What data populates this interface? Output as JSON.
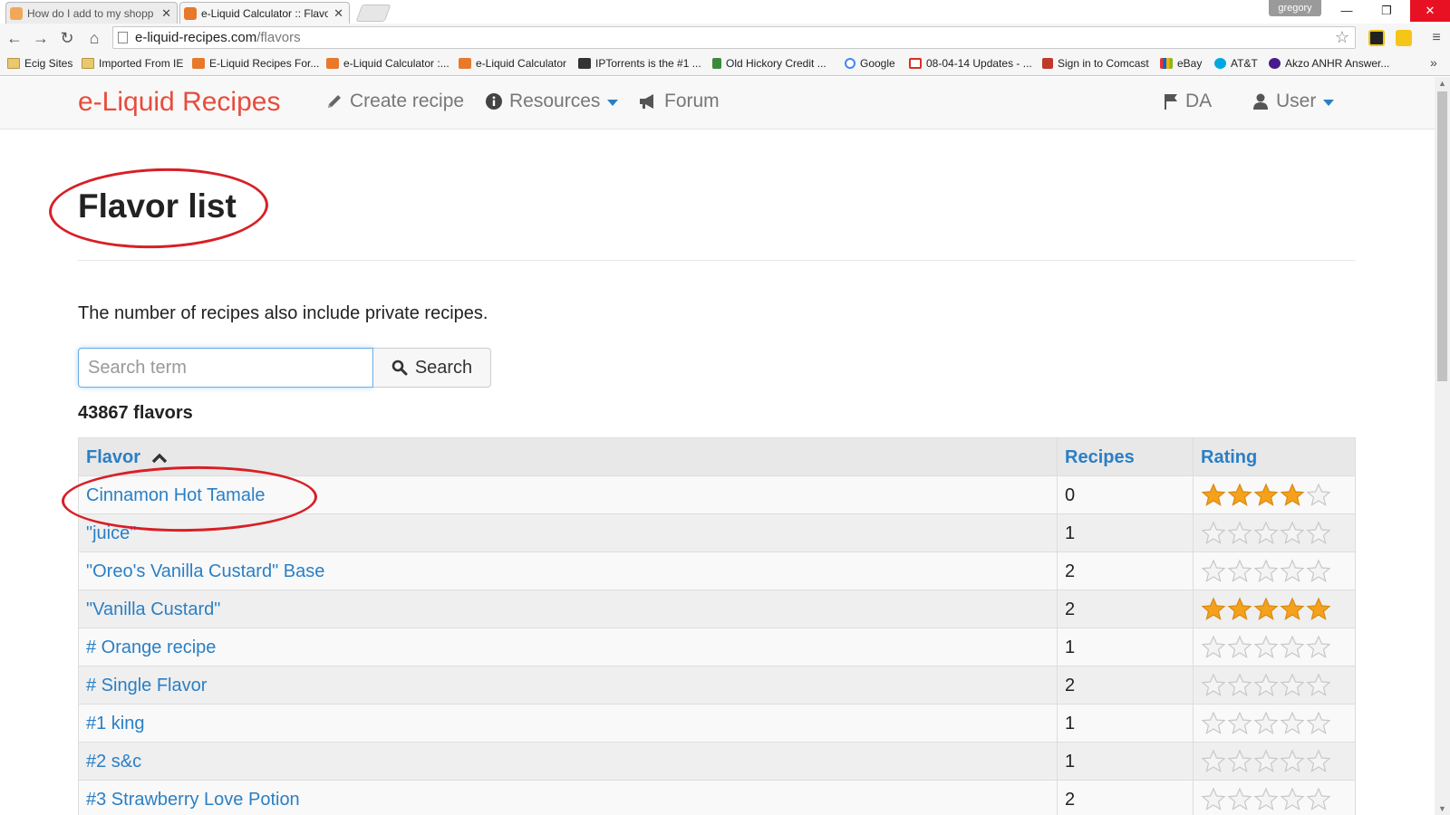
{
  "browser": {
    "tabs": [
      {
        "title": "How do I add to my shopp",
        "active": false
      },
      {
        "title": "e-Liquid Calculator :: Flavo",
        "active": true
      }
    ],
    "profile_name": "gregory",
    "url_host": "e-liquid-recipes.com",
    "url_path": "/flavors",
    "bookmarks": [
      {
        "label": "Ecig Sites",
        "icon": "folder-icon"
      },
      {
        "label": "Imported From IE",
        "icon": "folder-icon"
      },
      {
        "label": "E-Liquid Recipes For...",
        "icon": "eliquid-favicon"
      },
      {
        "label": "e-Liquid Calculator :...",
        "icon": "eliquid-favicon"
      },
      {
        "label": "e-Liquid Calculator",
        "icon": "eliquid-favicon"
      },
      {
        "label": "IPTorrents is the #1 ...",
        "icon": "ipt-favicon"
      },
      {
        "label": "Old Hickory Credit ...",
        "icon": "oldhickory-favicon"
      },
      {
        "label": "Google",
        "icon": "google-favicon"
      },
      {
        "label": "08-04-14 Updates - ...",
        "icon": "gmail-favicon"
      },
      {
        "label": "Sign in to Comcast",
        "icon": "xfinity-favicon"
      },
      {
        "label": "eBay",
        "icon": "ebay-favicon"
      },
      {
        "label": "AT&T",
        "icon": "att-favicon"
      },
      {
        "label": "Akzo ANHR Answer...",
        "icon": "akzo-favicon"
      }
    ]
  },
  "site": {
    "brand": "e-Liquid Recipes",
    "nav": {
      "create": "Create recipe",
      "resources": "Resources",
      "forum": "Forum",
      "language": "DA",
      "user": "User"
    }
  },
  "page": {
    "title": "Flavor list",
    "note": "The number of recipes also include private recipes.",
    "search": {
      "placeholder": "Search term",
      "button": "Search"
    },
    "count": "43867 flavors"
  },
  "table": {
    "headers": {
      "flavor": "Flavor",
      "recipes": "Recipes",
      "rating": "Rating"
    },
    "sort": "flavor-ascending",
    "rows": [
      {
        "flavor": "Cinnamon Hot Tamale",
        "recipes": "0",
        "rating": 4
      },
      {
        "flavor": "\"juice\"",
        "recipes": "1",
        "rating": 0
      },
      {
        "flavor": "\"Oreo's Vanilla Custard\" Base",
        "recipes": "2",
        "rating": 0
      },
      {
        "flavor": "\"Vanilla Custard\"",
        "recipes": "2",
        "rating": 5
      },
      {
        "flavor": "# Orange recipe",
        "recipes": "1",
        "rating": 0
      },
      {
        "flavor": "# Single Flavor",
        "recipes": "2",
        "rating": 0
      },
      {
        "flavor": "#1 king",
        "recipes": "1",
        "rating": 0
      },
      {
        "flavor": "#2 s&c",
        "recipes": "1",
        "rating": 0
      },
      {
        "flavor": "#3 Strawberry Love Potion",
        "recipes": "2",
        "rating": 0
      }
    ]
  },
  "colors": {
    "brand": "#e74c3c",
    "link": "#2a7fc5",
    "star_filled": "#f5a11c",
    "annotation": "#d81f26",
    "window_close": "#e81123"
  }
}
